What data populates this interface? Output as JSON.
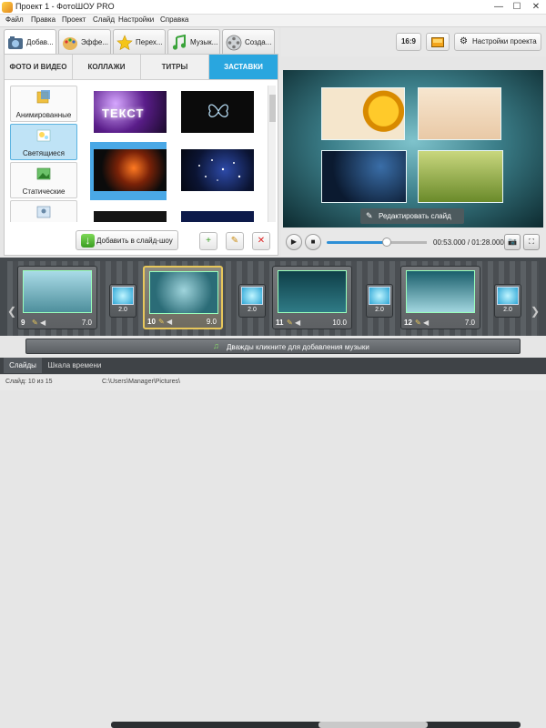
{
  "window": {
    "title": "Проект 1 - ФотоШОУ PRO"
  },
  "menu": [
    "Файл",
    "Правка",
    "Проект",
    "Слайд",
    "Настройки",
    "Справка"
  ],
  "tabs": [
    {
      "label": "Добав..."
    },
    {
      "label": "Эффе..."
    },
    {
      "label": "Перех..."
    },
    {
      "label": "Музык..."
    },
    {
      "label": "Созда..."
    }
  ],
  "categories": [
    "ФОТО И ВИДЕО",
    "КОЛЛАЖИ",
    "ТИТРЫ",
    "ЗАСТАВКИ"
  ],
  "subcategories": [
    "Анимированные",
    "Светящиеся",
    "Статические"
  ],
  "thumbs": [
    "ТЕКСТ"
  ],
  "add_button": "Добавить в слайд-шоу",
  "top_right": {
    "aspect": "16:9",
    "settings": "Настройки проекта"
  },
  "preview": {
    "edit_button": "Редактировать слайд"
  },
  "player": {
    "time": "00:53.000 / 01:28.000",
    "progress": 0.6
  },
  "slides": [
    {
      "num": "9",
      "dur": "7.0"
    },
    {
      "num": "10",
      "dur": "9.0"
    },
    {
      "num": "11",
      "dur": "10.0"
    },
    {
      "num": "12",
      "dur": "7.0"
    }
  ],
  "transitions": [
    "2.0",
    "2.0",
    "2.0",
    "2.0"
  ],
  "music_hint": "Дважды кликните для добавления музыки",
  "bottom_tabs": [
    "Слайды",
    "Шкала времени"
  ],
  "status": {
    "slide": "Слайд: 10 из 15",
    "path": "C:\\Users\\Manager\\Pictures\\"
  }
}
